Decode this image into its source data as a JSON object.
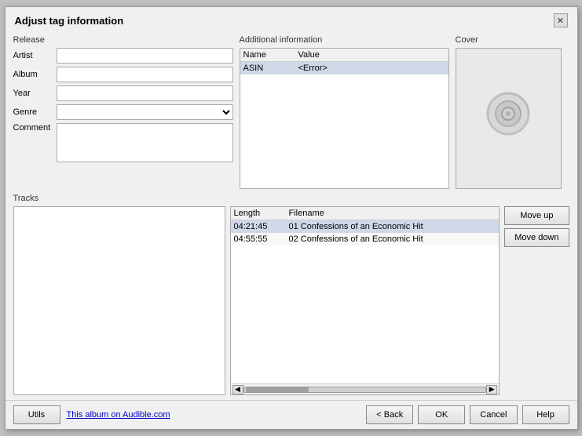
{
  "dialog": {
    "title": "Adjust tag information",
    "close_label": "✕"
  },
  "release": {
    "section_label": "Release",
    "artist_label": "Artist",
    "artist_value": "",
    "album_label": "Album",
    "album_value": "",
    "year_label": "Year",
    "year_value": "",
    "genre_label": "Genre",
    "genre_value": "",
    "comment_label": "Comment",
    "comment_value": ""
  },
  "additional": {
    "section_label": "Additional information",
    "col_name": "Name",
    "col_value": "Value",
    "rows": [
      {
        "name": "ASIN",
        "value": "<Error>"
      }
    ]
  },
  "cover": {
    "section_label": "Cover",
    "icon": "💿"
  },
  "tracks": {
    "section_label": "Tracks",
    "col_length": "Length",
    "col_filename": "Filename",
    "rows": [
      {
        "length": "04:21:45",
        "filename": "01 Confessions of an Economic Hit",
        "selected": true
      },
      {
        "length": "04:55:55",
        "filename": "02 Confessions of an Economic Hit",
        "selected": false
      }
    ],
    "move_up_label": "Move up",
    "move_down_label": "Move down"
  },
  "bottom": {
    "utils_label": "Utils",
    "audible_link": "This album on Audible.com",
    "back_label": "< Back",
    "ok_label": "OK",
    "cancel_label": "Cancel",
    "help_label": "Help"
  }
}
